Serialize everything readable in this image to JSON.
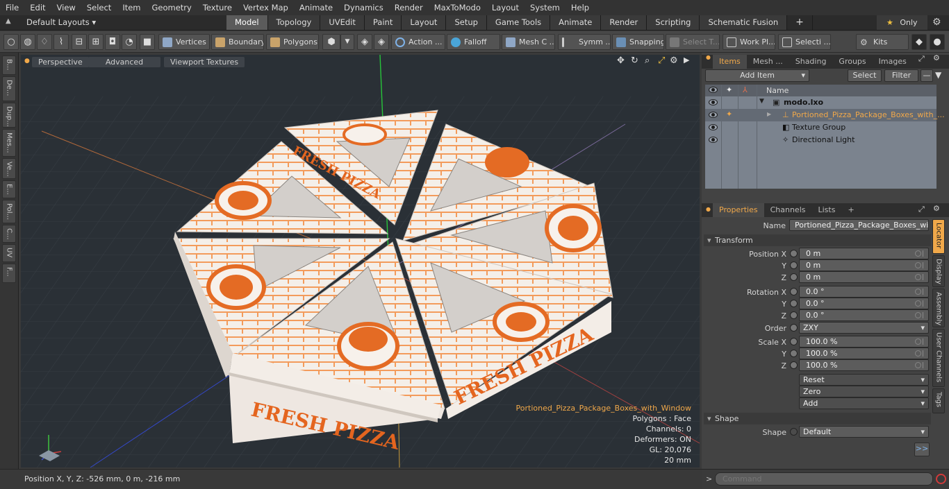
{
  "menu": [
    "File",
    "Edit",
    "View",
    "Select",
    "Item",
    "Geometry",
    "Texture",
    "Vertex Map",
    "Animate",
    "Dynamics",
    "Render",
    "MaxToModo",
    "Layout",
    "System",
    "Help"
  ],
  "layout": {
    "preset": "Default Layouts ▾",
    "tabs": [
      "Model",
      "Topology",
      "UVEdit",
      "Paint",
      "Layout",
      "Setup",
      "Game Tools",
      "Animate",
      "Render",
      "Scripting",
      "Schematic Fusion"
    ],
    "add": "+",
    "only": "Only"
  },
  "toolbar": {
    "vertices": "Vertices",
    "boundary": "Boundary",
    "polygons": "Polygons",
    "action": "Action ...",
    "falloff": "Falloff",
    "mesh": "Mesh C ...",
    "symm": "Symm ...",
    "snapping": "Snapping",
    "select_t": "Select T...",
    "workpl": "Work Pl...",
    "selecti": "Selecti ...",
    "kits": "Kits"
  },
  "left_tabs": [
    "B...",
    "De...",
    "Dup...",
    "Mes...",
    "Ve...",
    "E...",
    "Pol...",
    "C...",
    "UV",
    "F..."
  ],
  "viewport": {
    "perspective": "Perspective",
    "advanced": "Advanced",
    "textures": "Viewport Textures",
    "info": {
      "name": "Portioned_Pizza_Package_Boxes_with_Window",
      "polygons": "Polygons : Face",
      "channels": "Channels: 0",
      "deformers": "Deformers: ON",
      "gl": "GL: 20,076",
      "scale": "20 mm"
    },
    "box_text": "FRESH PIZZA"
  },
  "status": {
    "position": "Position X, Y, Z:   -526 mm, 0 m, -216 mm"
  },
  "items_panel": {
    "tabs": [
      "Items",
      "Mesh ...",
      "Shading",
      "Groups",
      "Images"
    ],
    "add_item": "Add Item",
    "select": "Select",
    "filter": "Filter",
    "col_name": "Name",
    "rows": [
      "modo.lxo",
      "Portioned_Pizza_Package_Boxes_with_...",
      "Texture Group",
      "Directional Light"
    ]
  },
  "properties": {
    "tabs": [
      "Properties",
      "Channels",
      "Lists"
    ],
    "add": "+",
    "name_label": "Name",
    "name_value": "Portioned_Pizza_Package_Boxes_with_",
    "transform": "Transform",
    "labels": {
      "pos_x": "Position X",
      "y": "Y",
      "z": "Z",
      "rot_x": "Rotation X",
      "order": "Order",
      "scale_x": "Scale X",
      "shape_label": "Shape"
    },
    "position": [
      "0 m",
      "0 m",
      "0 m"
    ],
    "rotation": [
      "0.0 °",
      "0.0 °",
      "0.0 °"
    ],
    "order": "ZXY",
    "scale": [
      "100.0 %",
      "100.0 %",
      "100.0 %"
    ],
    "reset": "Reset",
    "zero": "Zero",
    "add_btn": "Add",
    "shape_section": "Shape",
    "shape_value": "Default",
    "more": ">>",
    "side_tabs": [
      "Locator",
      "Display",
      "Assembly",
      "User Channels",
      "Tags"
    ]
  },
  "command": {
    "placeholder": "Command",
    "prompt": ">"
  }
}
